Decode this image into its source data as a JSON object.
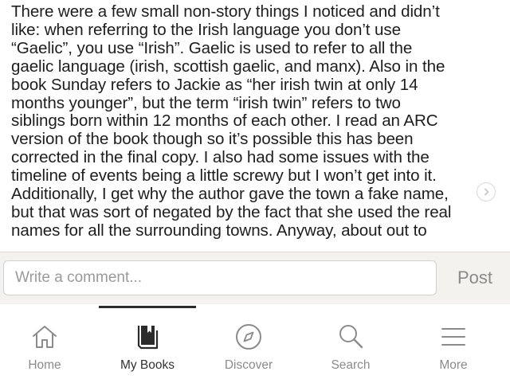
{
  "review": {
    "lines": [
      "There were a few small non-story things I noticed and didn’t",
      "like: when referring to the Irish language you don’t use",
      "“Gaelic”, you use “Irish”. Gaelic is used to refer to all the",
      "gaelic language (irish, scottish gaelic, and manx). Also in the",
      "book Sunday refers to Jackie as “her irish twin at only 14",
      "months younger”, but the term “irish twin” refers to two",
      "siblings born within 12 months of each other. I read an ARC",
      "version of the book though so it’s possible this has been",
      "corrected in the final copy. I also had some issues with the",
      "timeline of events being a little screwy but I won’t get into it.",
      "Additionally, I get why the author gave the town a fake name,",
      "but that was sort of negated by the fact that she used the real",
      "names for all the surrounding towns. Anyway, about out to"
    ]
  },
  "composer": {
    "placeholder": "Write a comment...",
    "value": "",
    "post_label": "Post"
  },
  "tabs": [
    {
      "label": "Home",
      "icon": "home-icon",
      "active": false
    },
    {
      "label": "My Books",
      "icon": "book-icon",
      "active": true
    },
    {
      "label": "Discover",
      "icon": "compass-icon",
      "active": false
    },
    {
      "label": "Search",
      "icon": "search-icon",
      "active": false
    },
    {
      "label": "More",
      "icon": "menu-icon",
      "active": false
    }
  ],
  "colors": {
    "text": "#1e1e1e",
    "composer_bg": "#f4f2ee",
    "tab_inactive": "#8b8b8b",
    "tab_active": "#333333"
  }
}
